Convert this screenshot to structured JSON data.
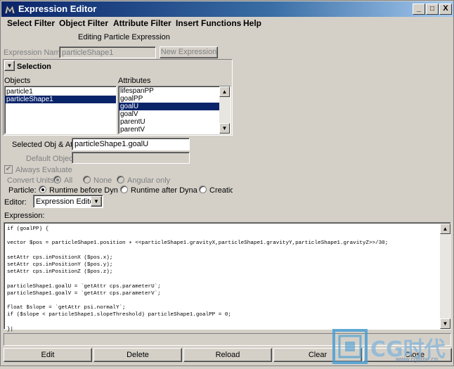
{
  "window": {
    "title": "Expression Editor",
    "minimize": "_",
    "maximize": "□",
    "close": "X"
  },
  "menu": [
    "Select Filter",
    "Object Filter",
    "Attribute Filter",
    "Insert Functions",
    "Help"
  ],
  "heading": "Editing Particle Expression",
  "expression_name": {
    "label": "Expression Name",
    "value": "particleShape1"
  },
  "new_expression_button": "New Expression",
  "selection": {
    "title": "Selection",
    "objects_label": "Objects",
    "attributes_label": "Attributes",
    "objects": [
      "particle1",
      "particleShape1"
    ],
    "selected_object": "particleShape1",
    "attributes": [
      "lifespanPP",
      "goalPP",
      "goalU",
      "goalV",
      "parentU",
      "parentV"
    ],
    "selected_attribute": "goalU"
  },
  "selected_obj_attr": {
    "label": "Selected Obj & Attr",
    "value": "particleShape1.goalU"
  },
  "default_object": {
    "label": "Default Object",
    "value": ""
  },
  "always_evaluate": {
    "label": "Always Evaluate",
    "checked": true
  },
  "convert_units": {
    "label": "Convert Units:",
    "options": [
      "All",
      "None",
      "Angular only"
    ],
    "selected": "All"
  },
  "particle": {
    "label": "Particle:",
    "options": [
      "Runtime before Dynamics",
      "Runtime after Dynamics",
      "Creation"
    ],
    "selected": "Runtime before Dynamics"
  },
  "editor": {
    "label": "Editor:",
    "value": "Expression Editor"
  },
  "expression_label": "Expression:",
  "expression_lines": [
    "if (goalPP) {",
    "",
    "vector $pos = particleShape1.position + <<particleShape1.gravityX,particleShape1.gravityY,particleShape1.gravityZ>>/30;",
    "",
    "setAttr cps.inPositionX ($pos.x);",
    "setAttr cps.inPositionY ($pos.y);",
    "setAttr cps.inPositionZ ($pos.z);",
    "",
    "particleShape1.goalU = `getAttr cps.parameterU`;",
    "particleShape1.goalV = `getAttr cps.parameterV`;",
    "",
    "float $slope = `getAttr psi.normalY`;",
    "if ($slope < particleShape1.slopeThreshold) particleShape1.goalPP = 0;",
    "",
    "}|"
  ],
  "buttons": [
    "Edit",
    "Delete",
    "Reload",
    "Clear",
    "Close"
  ],
  "watermark": {
    "text": "CG时代",
    "url": "www.cgtime.cn"
  },
  "colors": {
    "title_start": "#0a246a",
    "title_end": "#a6caf0",
    "selection": "#0a246a",
    "face": "#d4d0c8"
  }
}
